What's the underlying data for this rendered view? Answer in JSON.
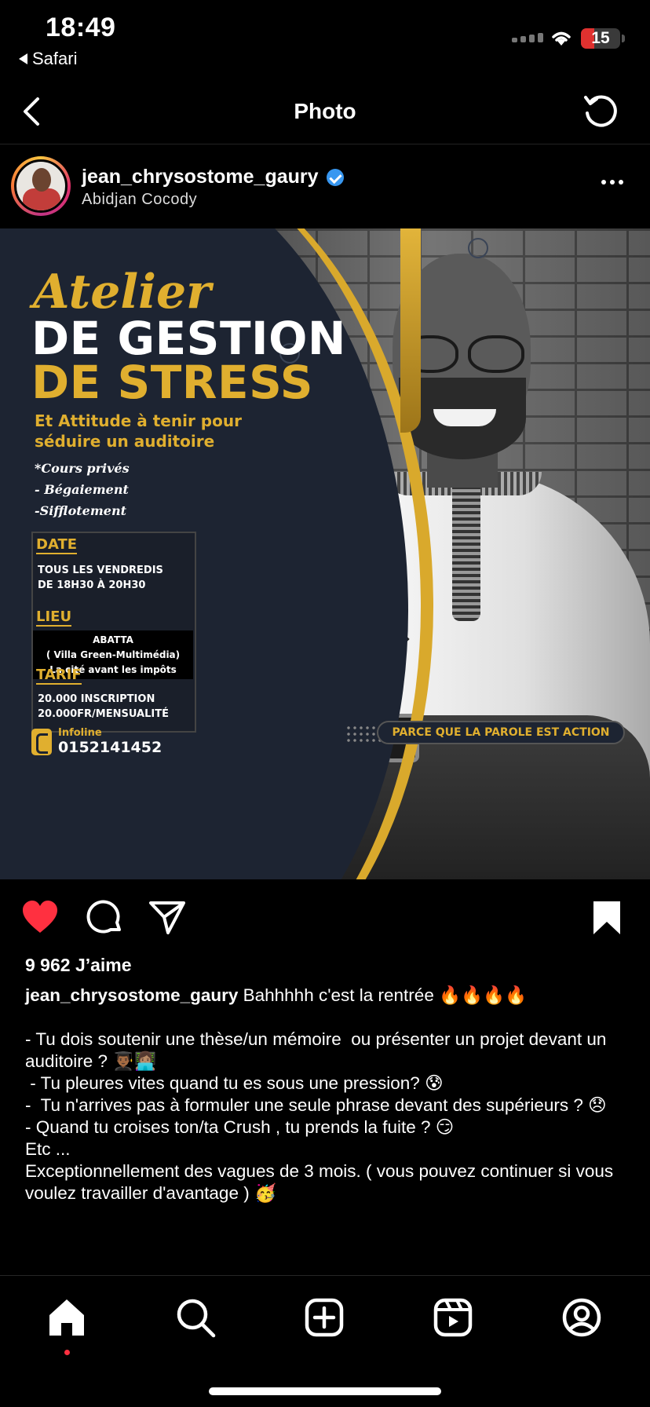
{
  "status_bar": {
    "time": "18:49",
    "back_app": "Safari",
    "battery": "15"
  },
  "nav": {
    "title": "Photo"
  },
  "post": {
    "username": "jean_chrysostome_gaury",
    "location": "Abidjan Cocody"
  },
  "poster": {
    "atelier": "Atelier",
    "title_line1": "DE GESTION",
    "title_line2": "DE STRESS",
    "subtitle": "Et Attitude à tenir pour séduire un auditoire",
    "bullets": [
      "*Cours privés",
      "- Bégaiement",
      "-Sifflotement"
    ],
    "date_label": "DATE",
    "date_value_1": "TOUS LES VENDREDIS",
    "date_value_2": "DE 18H30 À 20H30",
    "lieu_label": "LIEU",
    "lieu_value_1": "ABATTA",
    "lieu_value_2": "( Villa Green-Multimédia)",
    "lieu_value_3": "La cité avant les impôts",
    "tarif_label": "TARIF",
    "tarif_value_1": "20.000 INSCRIPTION",
    "tarif_value_2": "20.000FR/MENSUALITÉ",
    "infoline_label": "Infoline",
    "infoline_number": "0152141452",
    "tagline": "PARCE QUE LA PAROLE EST ACTION"
  },
  "engagement": {
    "likes": "9 962 J’aime"
  },
  "caption": {
    "user": "jean_chrysostome_gaury",
    "text": " Bahhhhh c'est la rentrée 🔥🔥🔥🔥\n\n- Tu dois soutenir une thèse/un mémoire  ou présenter un projet devant un auditoire ? 👨🏾‍🎓👩🏽‍💻\n - Tu pleures vites quand tu es sous une pression? 😰\n-  Tu n'arrives pas à formuler une seule phrase devant des supérieurs ? 😞\n- Quand tu croises ton/ta Crush , tu prends la fuite ? 😏\nEtc ...\nExceptionnellement des vagues de 3 mois. ( vous pouvez continuer si vous voulez travailler d'avantage ) 🥳"
  },
  "icons": {
    "like": "heart-icon-filled",
    "comment": "comment-icon",
    "share": "paper-plane-icon",
    "save": "bookmark-icon-filled",
    "tabs": [
      "home-icon",
      "search-icon",
      "create-icon",
      "reels-icon",
      "profile-icon"
    ]
  },
  "colors": {
    "like": "#ff3040",
    "accent_gold": "#e0af2f",
    "verified": "#3897f0"
  }
}
